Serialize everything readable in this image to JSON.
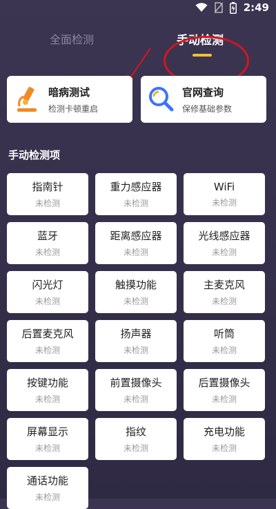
{
  "status_bar": {
    "time": "2:49",
    "icons": [
      "wifi-icon",
      "no-sim-icon",
      "battery-icon"
    ]
  },
  "tabs": [
    {
      "label": "全面检测",
      "active": false
    },
    {
      "label": "手动检测",
      "active": true
    }
  ],
  "colors": {
    "accent": "#f2c230",
    "annotation": "#d5151e",
    "background": "#34304a"
  },
  "features": [
    {
      "title": "暗病测试",
      "subtitle": "检测卡顿重启",
      "icon": "microscope-icon"
    },
    {
      "title": "官网查询",
      "subtitle": "保修基础参数",
      "icon": "magnifier-icon"
    }
  ],
  "section": {
    "title": "手动检测项"
  },
  "items": [
    {
      "name": "指南针",
      "status": "未检测"
    },
    {
      "name": "重力感应器",
      "status": "未检测"
    },
    {
      "name": "WiFi",
      "status": "未检测"
    },
    {
      "name": "蓝牙",
      "status": "未检测"
    },
    {
      "name": "距离感应器",
      "status": "未检测"
    },
    {
      "name": "光线感应器",
      "status": "未检测"
    },
    {
      "name": "闪光灯",
      "status": "未检测"
    },
    {
      "name": "触摸功能",
      "status": "未检测"
    },
    {
      "name": "主麦克风",
      "status": "未检测"
    },
    {
      "name": "后置麦克风",
      "status": "未检测"
    },
    {
      "name": "扬声器",
      "status": "未检测"
    },
    {
      "name": "听筒",
      "status": "未检测"
    },
    {
      "name": "按键功能",
      "status": "未检测"
    },
    {
      "name": "前置摄像头",
      "status": "未检测"
    },
    {
      "name": "后置摄像头",
      "status": "未检测"
    },
    {
      "name": "屏幕显示",
      "status": "未检测"
    },
    {
      "name": "指纹",
      "status": "未检测"
    },
    {
      "name": "充电功能",
      "status": "未检测"
    },
    {
      "name": "通话功能",
      "status": "未检测"
    }
  ]
}
